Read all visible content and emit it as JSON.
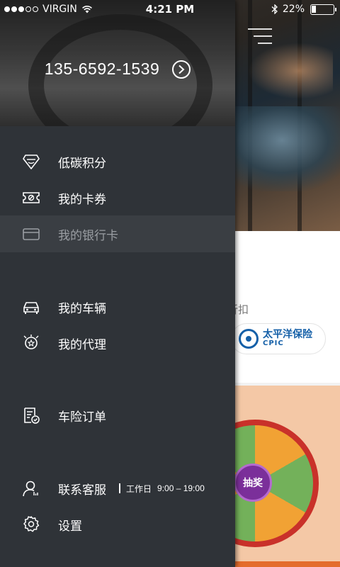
{
  "status_bar": {
    "carrier": "VIRGIN",
    "time": "4:21 PM",
    "battery_percent": "22%",
    "battery_level": 0.22,
    "signal_bars": 3
  },
  "drawer": {
    "phone": "135-6592-1539",
    "menu": {
      "points": "低碳积分",
      "coupons": "我的卡券",
      "bank_card": "我的银行卡",
      "vehicles": "我的车辆",
      "agency": "我的代理",
      "insurance_orders": "车险订单",
      "customer_service": "联系客服",
      "settings": "设置"
    },
    "service_hours": {
      "label": "工作日",
      "time": "9:00 – 19:00"
    }
  },
  "background": {
    "discount_text": "的折扣",
    "insurer_name": "太平洋保险",
    "insurer_code": "CPIC",
    "wheel_center_label": "抽奖"
  },
  "colors": {
    "drawer_bg": "#2f3338",
    "active_item_bg": "#3a3e43",
    "cpic_blue": "#1560a8"
  }
}
